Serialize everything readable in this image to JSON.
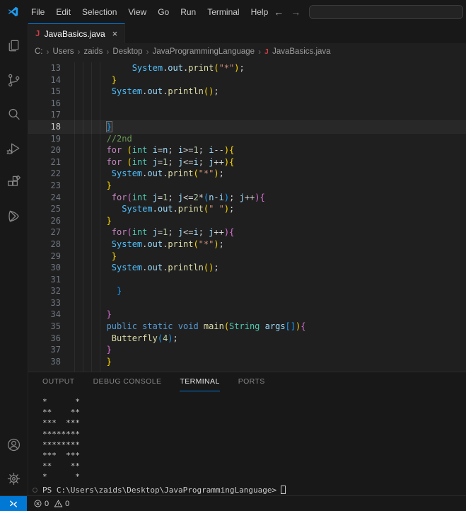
{
  "titlebar": {
    "menus": [
      "File",
      "Edit",
      "Selection",
      "View",
      "Go",
      "Run",
      "Terminal",
      "Help"
    ],
    "command_center_value": ""
  },
  "icons": {
    "back": "←",
    "forward": "→",
    "close": "×",
    "breadcrumb_separator": "›",
    "java_badge": "J"
  },
  "colors": {
    "accent": "#0078d4",
    "java_icon": "#cc3e44",
    "editor_bg": "#1f1f1f",
    "shell_bg": "#181818"
  },
  "activity_bar": {
    "items": [
      "explorer",
      "source-control",
      "search",
      "run-debug",
      "extensions",
      "custom-extension"
    ],
    "footer": [
      "account",
      "settings"
    ]
  },
  "editor": {
    "tab": {
      "label": "JavaBasics.java"
    },
    "breadcrumb": [
      "C:",
      "Users",
      "zaids",
      "Desktop",
      "JavaProgrammingLanguage",
      "JavaBasics.java"
    ],
    "cursor_line": 18,
    "lines": [
      {
        "n": 13,
        "tokens": [
          [
            "ws",
            "            "
          ],
          [
            "cls",
            "System"
          ],
          [
            "pln",
            "."
          ],
          [
            "var",
            "out"
          ],
          [
            "pln",
            "."
          ],
          [
            "fn",
            "print"
          ],
          [
            "b1",
            "("
          ],
          [
            "str",
            "\"*\""
          ],
          [
            "b1",
            ")"
          ],
          [
            "pln",
            ";"
          ]
        ]
      },
      {
        "n": 14,
        "tokens": [
          [
            "ws",
            "        "
          ],
          [
            "b1",
            "}"
          ]
        ]
      },
      {
        "n": 15,
        "tokens": [
          [
            "ws",
            "        "
          ],
          [
            "cls",
            "System"
          ],
          [
            "pln",
            "."
          ],
          [
            "var",
            "out"
          ],
          [
            "pln",
            "."
          ],
          [
            "fn",
            "println"
          ],
          [
            "b1",
            "("
          ],
          [
            "b1",
            ")"
          ],
          [
            "pln",
            ";"
          ]
        ]
      },
      {
        "n": 16,
        "tokens": []
      },
      {
        "n": 17,
        "tokens": []
      },
      {
        "n": 18,
        "tokens": [
          [
            "ws",
            "       "
          ],
          [
            "b3m",
            "}"
          ],
          [
            "cur",
            ""
          ]
        ]
      },
      {
        "n": 19,
        "tokens": [
          [
            "ws",
            "       "
          ],
          [
            "com",
            "//2nd"
          ]
        ]
      },
      {
        "n": 20,
        "tokens": [
          [
            "ws",
            "       "
          ],
          [
            "kw",
            "for"
          ],
          [
            "pln",
            " "
          ],
          [
            "b1",
            "("
          ],
          [
            "type",
            "int"
          ],
          [
            "pln",
            " "
          ],
          [
            "var",
            "i"
          ],
          [
            "pln",
            "="
          ],
          [
            "var",
            "n"
          ],
          [
            "pln",
            "; "
          ],
          [
            "var",
            "i"
          ],
          [
            "pln",
            ">="
          ],
          [
            "num",
            "1"
          ],
          [
            "pln",
            "; "
          ],
          [
            "var",
            "i"
          ],
          [
            "pln",
            "--"
          ],
          [
            "b1",
            ")"
          ],
          [
            "b1",
            "{"
          ]
        ]
      },
      {
        "n": 21,
        "tokens": [
          [
            "ws",
            "       "
          ],
          [
            "kw",
            "for"
          ],
          [
            "pln",
            " "
          ],
          [
            "b1",
            "("
          ],
          [
            "type",
            "int"
          ],
          [
            "pln",
            " "
          ],
          [
            "var",
            "j"
          ],
          [
            "pln",
            "="
          ],
          [
            "num",
            "1"
          ],
          [
            "pln",
            "; "
          ],
          [
            "var",
            "j"
          ],
          [
            "pln",
            "<="
          ],
          [
            "var",
            "i"
          ],
          [
            "pln",
            "; "
          ],
          [
            "var",
            "j"
          ],
          [
            "pln",
            "++"
          ],
          [
            "b1",
            ")"
          ],
          [
            "b1",
            "{"
          ]
        ]
      },
      {
        "n": 22,
        "tokens": [
          [
            "ws",
            "        "
          ],
          [
            "cls",
            "System"
          ],
          [
            "pln",
            "."
          ],
          [
            "var",
            "out"
          ],
          [
            "pln",
            "."
          ],
          [
            "fn",
            "print"
          ],
          [
            "b1",
            "("
          ],
          [
            "str",
            "\"*\""
          ],
          [
            "b1",
            ")"
          ],
          [
            "pln",
            ";"
          ]
        ]
      },
      {
        "n": 23,
        "tokens": [
          [
            "ws",
            "       "
          ],
          [
            "b1",
            "}"
          ]
        ]
      },
      {
        "n": 24,
        "tokens": [
          [
            "ws",
            "        "
          ],
          [
            "kw",
            "for"
          ],
          [
            "b2",
            "("
          ],
          [
            "type",
            "int"
          ],
          [
            "pln",
            " "
          ],
          [
            "var",
            "j"
          ],
          [
            "pln",
            "="
          ],
          [
            "num",
            "1"
          ],
          [
            "pln",
            "; "
          ],
          [
            "var",
            "j"
          ],
          [
            "pln",
            "<="
          ],
          [
            "num",
            "2"
          ],
          [
            "pln",
            "*"
          ],
          [
            "b3",
            "("
          ],
          [
            "var",
            "n"
          ],
          [
            "pln",
            "-"
          ],
          [
            "var",
            "i"
          ],
          [
            "b3",
            ")"
          ],
          [
            "pln",
            "; "
          ],
          [
            "var",
            "j"
          ],
          [
            "pln",
            "++"
          ],
          [
            "b2",
            ")"
          ],
          [
            "b2",
            "{"
          ]
        ]
      },
      {
        "n": 25,
        "tokens": [
          [
            "ws",
            "          "
          ],
          [
            "cls",
            "System"
          ],
          [
            "pln",
            "."
          ],
          [
            "var",
            "out"
          ],
          [
            "pln",
            "."
          ],
          [
            "fn",
            "print"
          ],
          [
            "b1",
            "("
          ],
          [
            "str",
            "\" \""
          ],
          [
            "b1",
            ")"
          ],
          [
            "pln",
            ";"
          ]
        ]
      },
      {
        "n": 26,
        "tokens": [
          [
            "ws",
            "       "
          ],
          [
            "b1",
            "}"
          ]
        ]
      },
      {
        "n": 27,
        "tokens": [
          [
            "ws",
            "        "
          ],
          [
            "kw",
            "for"
          ],
          [
            "b2",
            "("
          ],
          [
            "type",
            "int"
          ],
          [
            "pln",
            " "
          ],
          [
            "var",
            "j"
          ],
          [
            "pln",
            "="
          ],
          [
            "num",
            "1"
          ],
          [
            "pln",
            "; "
          ],
          [
            "var",
            "j"
          ],
          [
            "pln",
            "<="
          ],
          [
            "var",
            "i"
          ],
          [
            "pln",
            "; "
          ],
          [
            "var",
            "j"
          ],
          [
            "pln",
            "++"
          ],
          [
            "b2",
            ")"
          ],
          [
            "b2",
            "{"
          ]
        ]
      },
      {
        "n": 28,
        "tokens": [
          [
            "ws",
            "        "
          ],
          [
            "cls",
            "System"
          ],
          [
            "pln",
            "."
          ],
          [
            "var",
            "out"
          ],
          [
            "pln",
            "."
          ],
          [
            "fn",
            "print"
          ],
          [
            "b1",
            "("
          ],
          [
            "str",
            "\"*\""
          ],
          [
            "b1",
            ")"
          ],
          [
            "pln",
            ";"
          ]
        ]
      },
      {
        "n": 29,
        "tokens": [
          [
            "ws",
            "        "
          ],
          [
            "b1",
            "}"
          ]
        ]
      },
      {
        "n": 30,
        "tokens": [
          [
            "ws",
            "        "
          ],
          [
            "cls",
            "System"
          ],
          [
            "pln",
            "."
          ],
          [
            "var",
            "out"
          ],
          [
            "pln",
            "."
          ],
          [
            "fn",
            "println"
          ],
          [
            "b1",
            "("
          ],
          [
            "b1",
            ")"
          ],
          [
            "pln",
            ";"
          ]
        ]
      },
      {
        "n": 31,
        "tokens": []
      },
      {
        "n": 32,
        "tokens": [
          [
            "ws",
            "         "
          ],
          [
            "b3",
            "}"
          ]
        ]
      },
      {
        "n": 33,
        "tokens": []
      },
      {
        "n": 34,
        "tokens": [
          [
            "ws",
            "       "
          ],
          [
            "b2",
            "}"
          ]
        ]
      },
      {
        "n": 35,
        "tokens": [
          [
            "ws",
            "       "
          ],
          [
            "kw2",
            "public"
          ],
          [
            "pln",
            " "
          ],
          [
            "kw2",
            "static"
          ],
          [
            "pln",
            " "
          ],
          [
            "kw2",
            "void"
          ],
          [
            "pln",
            " "
          ],
          [
            "fn",
            "main"
          ],
          [
            "b1",
            "("
          ],
          [
            "type",
            "String"
          ],
          [
            "pln",
            " "
          ],
          [
            "var",
            "args"
          ],
          [
            "b3",
            "["
          ],
          [
            "b3",
            "]"
          ],
          [
            "b1",
            ")"
          ],
          [
            "b2",
            "{"
          ]
        ]
      },
      {
        "n": 36,
        "tokens": [
          [
            "ws",
            "        "
          ],
          [
            "fn",
            "Butterfly"
          ],
          [
            "b3",
            "("
          ],
          [
            "num",
            "4"
          ],
          [
            "b3",
            ")"
          ],
          [
            "pln",
            ";"
          ]
        ]
      },
      {
        "n": 37,
        "tokens": [
          [
            "ws",
            "       "
          ],
          [
            "b2",
            "}"
          ]
        ]
      },
      {
        "n": 38,
        "tokens": [
          [
            "ws",
            "       "
          ],
          [
            "b1",
            "}"
          ]
        ]
      }
    ]
  },
  "panel": {
    "tabs": [
      {
        "label": "OUTPUT",
        "active": false
      },
      {
        "label": "DEBUG CONSOLE",
        "active": false
      },
      {
        "label": "TERMINAL",
        "active": true
      },
      {
        "label": "PORTS",
        "active": false
      }
    ],
    "terminal": {
      "output": [
        "*      *",
        "**    **",
        "***  ***",
        "********",
        "********",
        "***  ***",
        "**    **",
        "*      *"
      ],
      "prompt": "PS C:\\Users\\zaids\\Desktop\\JavaProgrammingLanguage>"
    }
  },
  "status_bar": {
    "errors": "0",
    "warnings": "0"
  }
}
